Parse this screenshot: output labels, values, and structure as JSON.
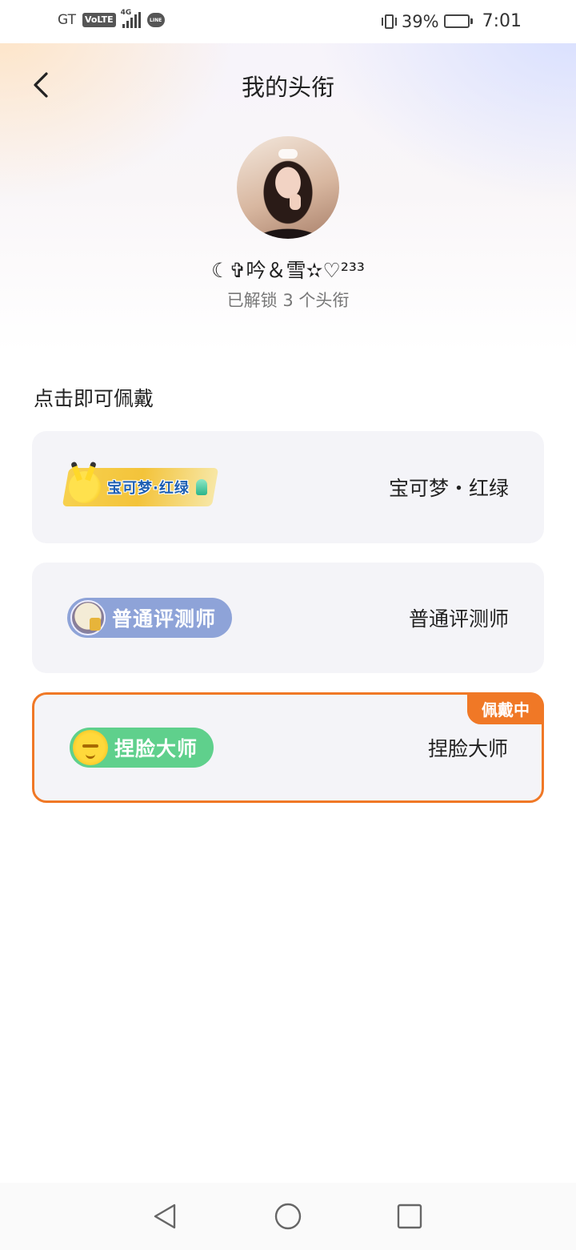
{
  "status_bar": {
    "carrier": "GT",
    "volte": "VoLTE",
    "network": "4G",
    "line_app": "LINE",
    "battery_percent": "39%",
    "battery_level": 0.39,
    "time": "7:01"
  },
  "header": {
    "title": "我的头衔",
    "back_icon": "chevron-left-icon"
  },
  "profile": {
    "username": "☾✞吟＆雪✫♡²³³",
    "unlocked_text": "已解锁 3 个头衔"
  },
  "section": {
    "title": "点击即可佩戴"
  },
  "titles": [
    {
      "badge_text": "宝可梦·红绿",
      "name": "宝可梦・红绿",
      "badge_icon": "pikachu-icon",
      "badge_color": "#f3c33a",
      "wearing": false
    },
    {
      "badge_text": "普通评测师",
      "name": "普通评测师",
      "badge_icon": "reviewer-avatar-icon",
      "badge_color": "#8ea3d8",
      "wearing": false
    },
    {
      "badge_text": "捏脸大师",
      "name": "捏脸大师",
      "badge_icon": "yellow-face-icon",
      "badge_color": "#5fd08c",
      "wearing": true
    }
  ],
  "wearing_label": "佩戴中",
  "accent_color": "#f07826",
  "nav_bar": {
    "back_icon": "triangle-back-icon",
    "home_icon": "circle-home-icon",
    "recent_icon": "square-recent-icon"
  }
}
